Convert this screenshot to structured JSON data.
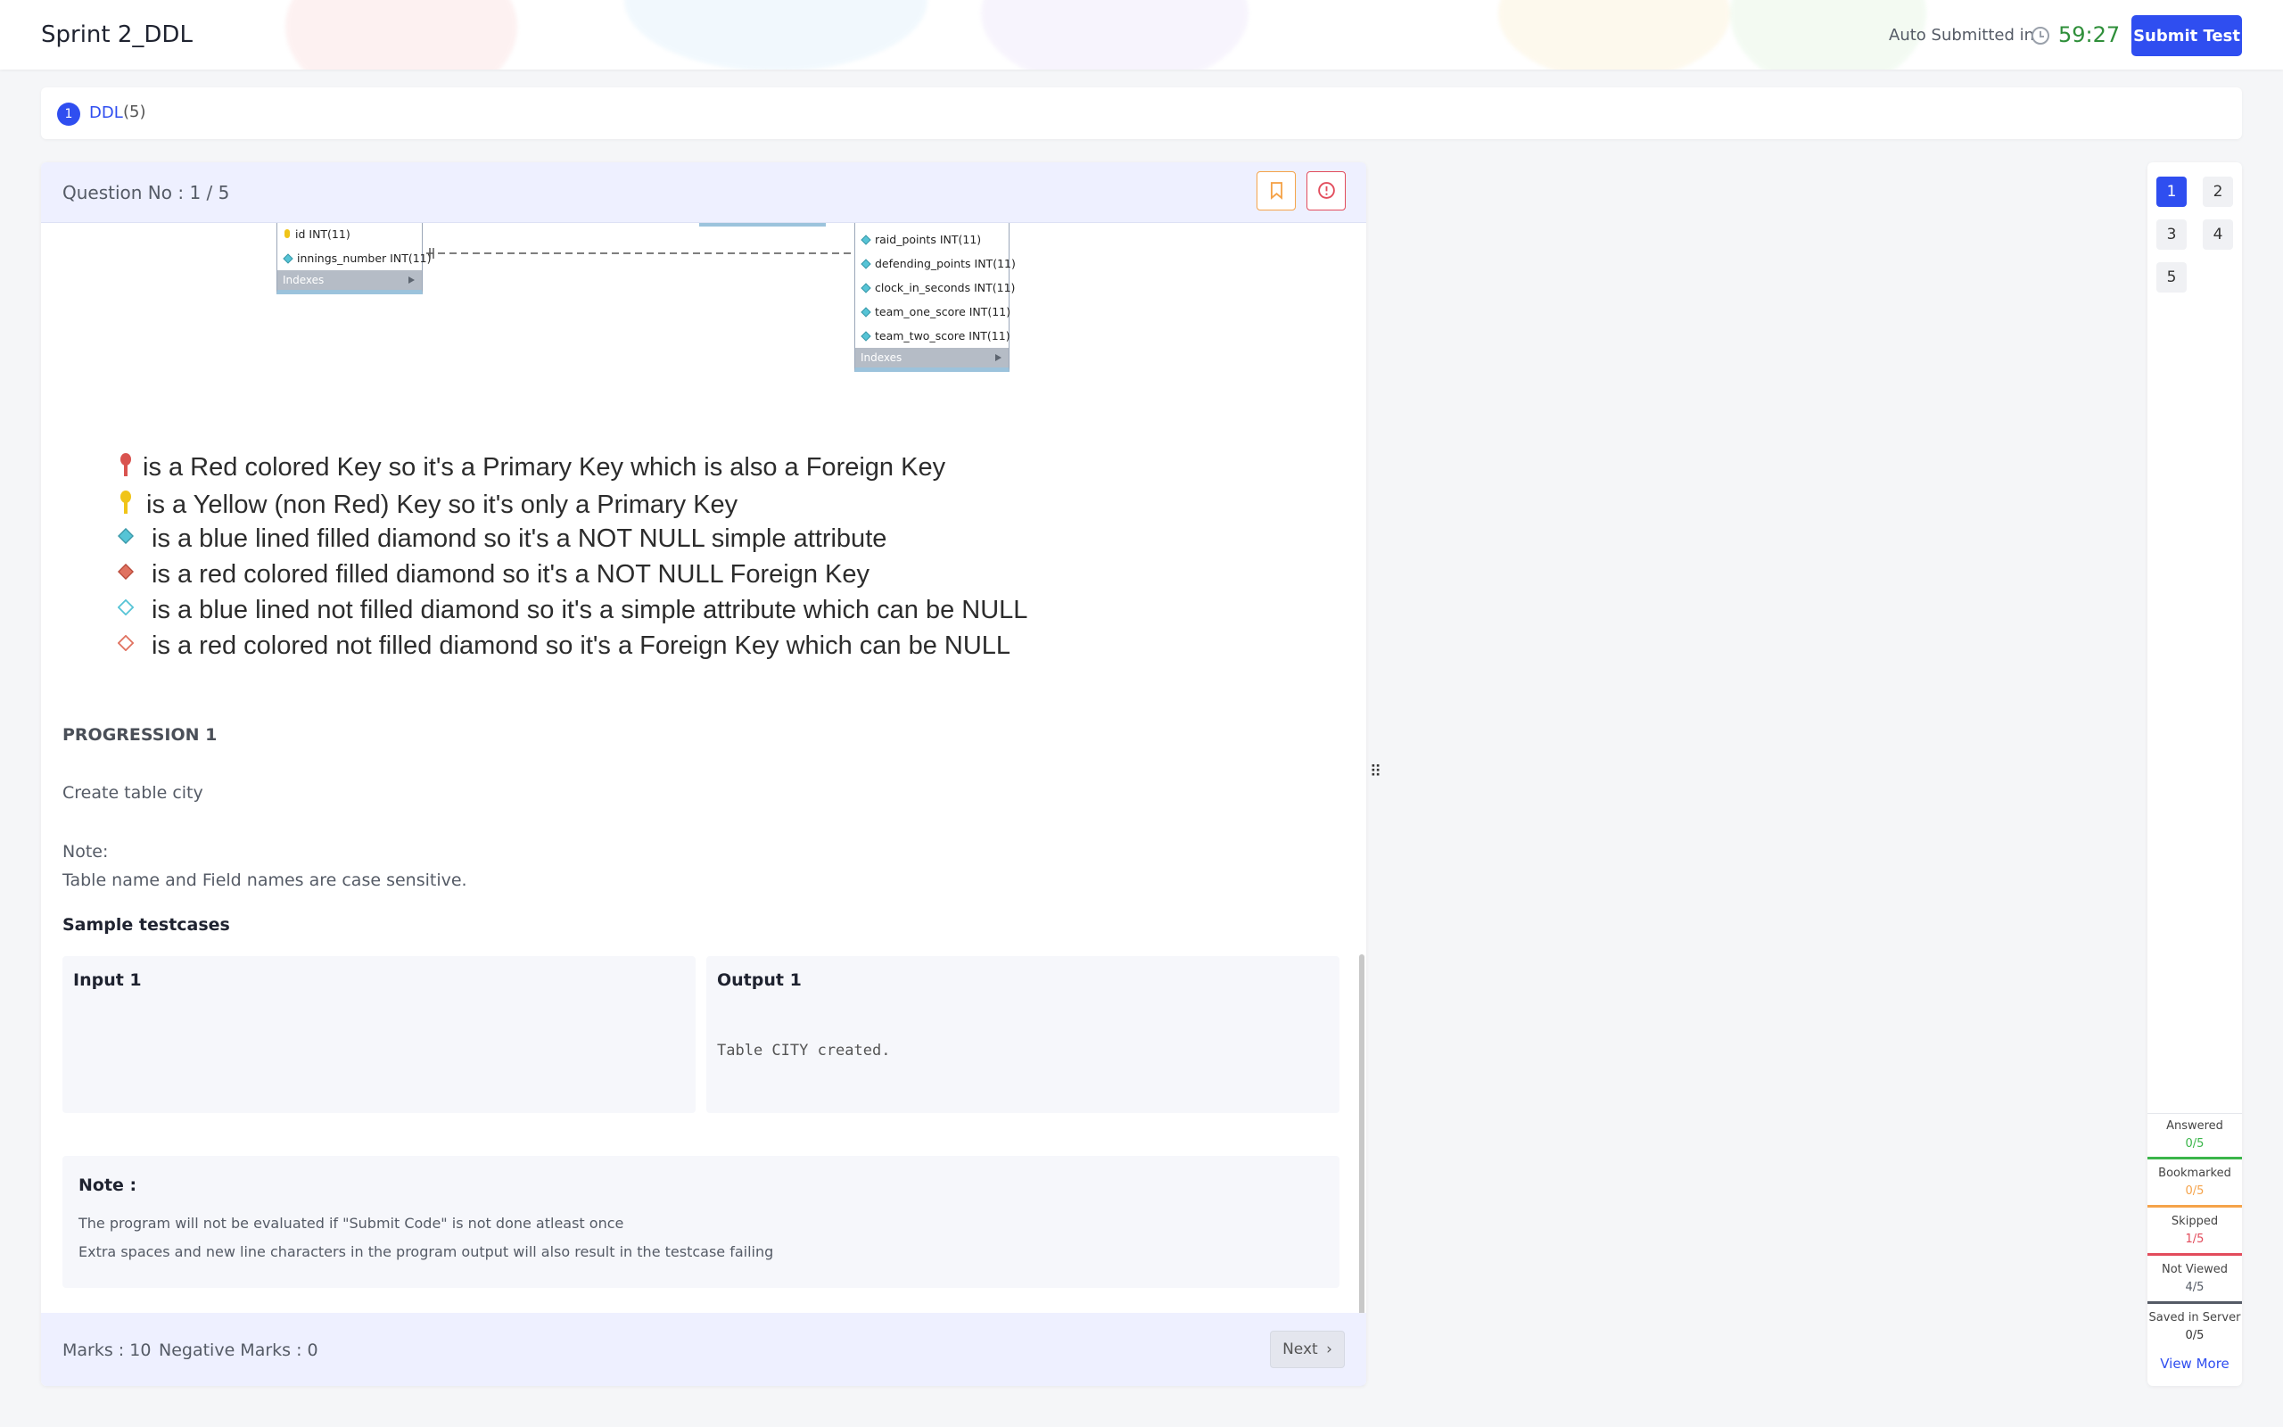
{
  "header": {
    "title": "Sprint 2_DDL",
    "auto_label": "Auto Submitted in",
    "timer": "59:27",
    "submit_label": "Submit Test"
  },
  "sections": [
    {
      "index": "1",
      "name": "DDL",
      "count": "(5)"
    }
  ],
  "question": {
    "number_label": "Question No : 1 / 5",
    "erd_left": {
      "rows": [
        "id INT(11)",
        "innings_number INT(11)"
      ],
      "index_label": "Indexes"
    },
    "erd_right": {
      "rows": [
        "raid_points INT(11)",
        "defending_points INT(11)",
        "clock_in_seconds INT(11)",
        "team_one_score INT(11)",
        "team_two_score INT(11)"
      ],
      "index_label": "Indexes"
    },
    "legend": [
      "is a Red colored Key so it's a Primary Key which is also a Foreign Key",
      "is a Yellow (non Red) Key so it's only a Primary Key",
      "is a blue lined filled diamond so it's a NOT NULL simple attribute",
      "is a red colored filled diamond so it's a NOT NULL Foreign Key",
      "is a blue lined not filled diamond so it's a simple attribute which can be NULL",
      "is a red colored not filled diamond so it's a Foreign Key which can be NULL"
    ],
    "progression_title": "PROGRESSION 1",
    "task": "Create table city",
    "note_label": "Note:",
    "note_text": "Table name and Field names are case sensitive.",
    "sample_title": "Sample testcases",
    "input_label": "Input 1",
    "output_label": "Output 1",
    "output_value": "Table CITY created.",
    "note_box_title": "Note :",
    "note_box_lines": [
      "The program will not be evaluated if \"Submit Code\" is not done atleast once",
      "Extra spaces and new line characters in the program output will also result in the testcase failing"
    ],
    "marks": "Marks : 10",
    "negative_marks": "Negative Marks : 0",
    "next_label": "Next"
  },
  "navigator": {
    "numbers": [
      "1",
      "2",
      "3",
      "4",
      "5"
    ],
    "active": "1",
    "stats": [
      {
        "label": "Answered",
        "value": "0/5",
        "color": "#3bb54a"
      },
      {
        "label": "Bookmarked",
        "value": "0/5",
        "color": "#f5a34a"
      },
      {
        "label": "Skipped",
        "value": "1/5",
        "color": "#e24c5c"
      },
      {
        "label": "Not Viewed",
        "value": "4/5",
        "color": "#555b66"
      },
      {
        "label": "Saved in Server",
        "value": "0/5",
        "color": "#333333"
      }
    ],
    "view_more": "View More"
  },
  "colors": {
    "accent": "#2f4ef0",
    "timer": "#2f8f3a",
    "bookmark": "#f5a34a",
    "report": "#e24c5c"
  }
}
